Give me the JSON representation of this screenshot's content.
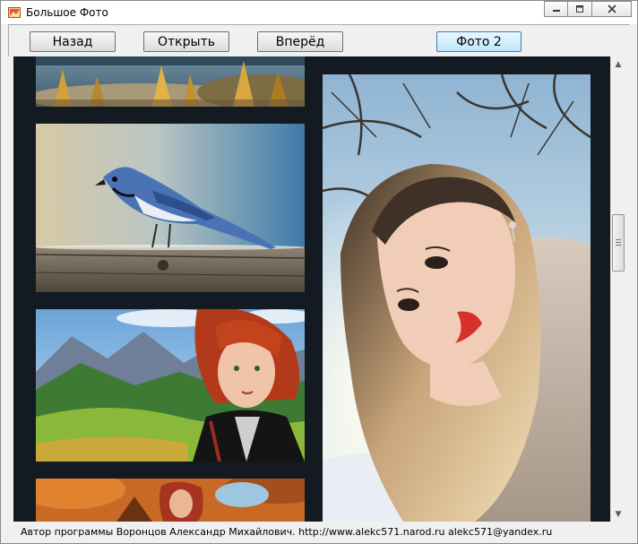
{
  "window": {
    "title": "Большое Фото",
    "icon": "app-photo-icon",
    "controls": {
      "minimize_icon": "minimize-icon",
      "maximize_icon": "maximize-icon",
      "close_icon": "close-icon"
    }
  },
  "toolbar": {
    "back_label": "Назад",
    "open_label": "Открыть",
    "forward_label": "Вперёд",
    "photo2_label": "Фото 2"
  },
  "gallery": {
    "background": "#131a21",
    "left_column": [
      {
        "subject": "autumn lake landscape (partially visible)"
      },
      {
        "subject": "blue jay on wooden plank"
      },
      {
        "subject": "red-haired woman in mountain valley"
      },
      {
        "subject": "red-haired woman among autumn trees (partially visible)"
      }
    ],
    "featured": {
      "subject": "blonde woman in fur coat with winter trees"
    }
  },
  "status": {
    "text": "Автор программы Воронцов Александр Михайлович.  http://www.alekc571.narod.ru  alekc571@yandex.ru"
  },
  "colors": {
    "window_bg": "#f0f0f0",
    "active_button": "#bee6fd",
    "active_button_border": "#3c7fb1"
  }
}
